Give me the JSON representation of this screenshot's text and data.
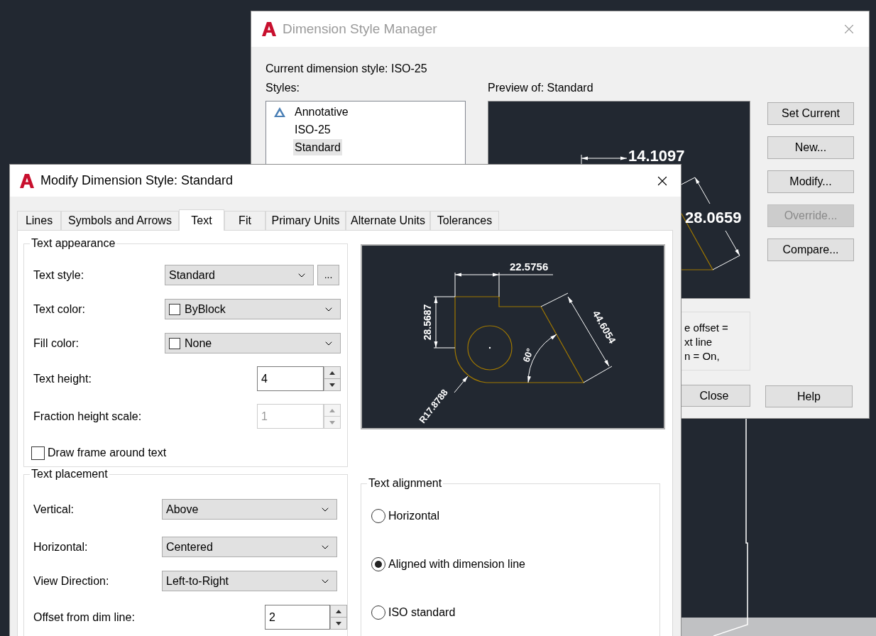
{
  "manager": {
    "title": "Dimension Style Manager",
    "current_style": "Current dimension style: ISO-25",
    "styles_label": "Styles:",
    "styles": [
      {
        "name": "Annotative",
        "annotative": true,
        "selected": false
      },
      {
        "name": "ISO-25",
        "annotative": false,
        "selected": false
      },
      {
        "name": "Standard",
        "annotative": false,
        "selected": true
      }
    ],
    "preview_label": "Preview of: Standard",
    "preview_labels": [
      "14.1097",
      "28.0659"
    ],
    "buttons": [
      {
        "label": "Set Current",
        "disabled": false
      },
      {
        "label": "New...",
        "disabled": false
      },
      {
        "label": "Modify...",
        "disabled": false
      },
      {
        "label": "Override...",
        "disabled": true
      },
      {
        "label": "Compare...",
        "disabled": false
      }
    ],
    "description": [
      "e offset =",
      "xt line",
      "n = On,"
    ],
    "footer_buttons": [
      "Close",
      "Help"
    ]
  },
  "modify": {
    "title": "Modify Dimension Style: Standard",
    "tabs": [
      {
        "label": "Lines",
        "selected": false
      },
      {
        "label": "Symbols and Arrows",
        "selected": false
      },
      {
        "label": "Text",
        "selected": true
      },
      {
        "label": "Fit",
        "selected": false
      },
      {
        "label": "Primary Units",
        "selected": false
      },
      {
        "label": "Alternate Units",
        "selected": false
      },
      {
        "label": "Tolerances",
        "selected": false
      }
    ],
    "text_appearance": {
      "title": "Text appearance",
      "rows": [
        {
          "kind": "combo",
          "label": "Text style:",
          "value": "Standard",
          "browse": "..."
        },
        {
          "kind": "color",
          "label": "Text color:",
          "value": "ByBlock"
        },
        {
          "kind": "color",
          "label": "Fill color:",
          "value": "None"
        },
        {
          "kind": "spinner",
          "label": "Text height:",
          "value": "4",
          "disabled": false
        },
        {
          "kind": "spinner",
          "label": "Fraction height scale:",
          "value": "1",
          "disabled": true
        }
      ],
      "frame_checkbox": {
        "label": "Draw frame around text",
        "checked": false
      }
    },
    "preview_labels": [
      "22.5756",
      "28.5687",
      "44.6054",
      "60°",
      "R17.8788"
    ],
    "text_placement": {
      "title": "Text placement",
      "rows": [
        {
          "kind": "combo",
          "label": "Vertical:",
          "value": "Above"
        },
        {
          "kind": "combo",
          "label": "Horizontal:",
          "value": "Centered"
        },
        {
          "kind": "combo",
          "label": "View Direction:",
          "value": "Left-to-Right"
        },
        {
          "kind": "spinner",
          "label": "Offset from dim line:",
          "value": "2",
          "disabled": false
        }
      ]
    },
    "text_alignment": {
      "title": "Text alignment",
      "options": [
        {
          "label": "Horizontal",
          "selected": false
        },
        {
          "label": "Aligned with dimension line",
          "selected": true
        },
        {
          "label": "ISO standard",
          "selected": false
        }
      ]
    }
  }
}
